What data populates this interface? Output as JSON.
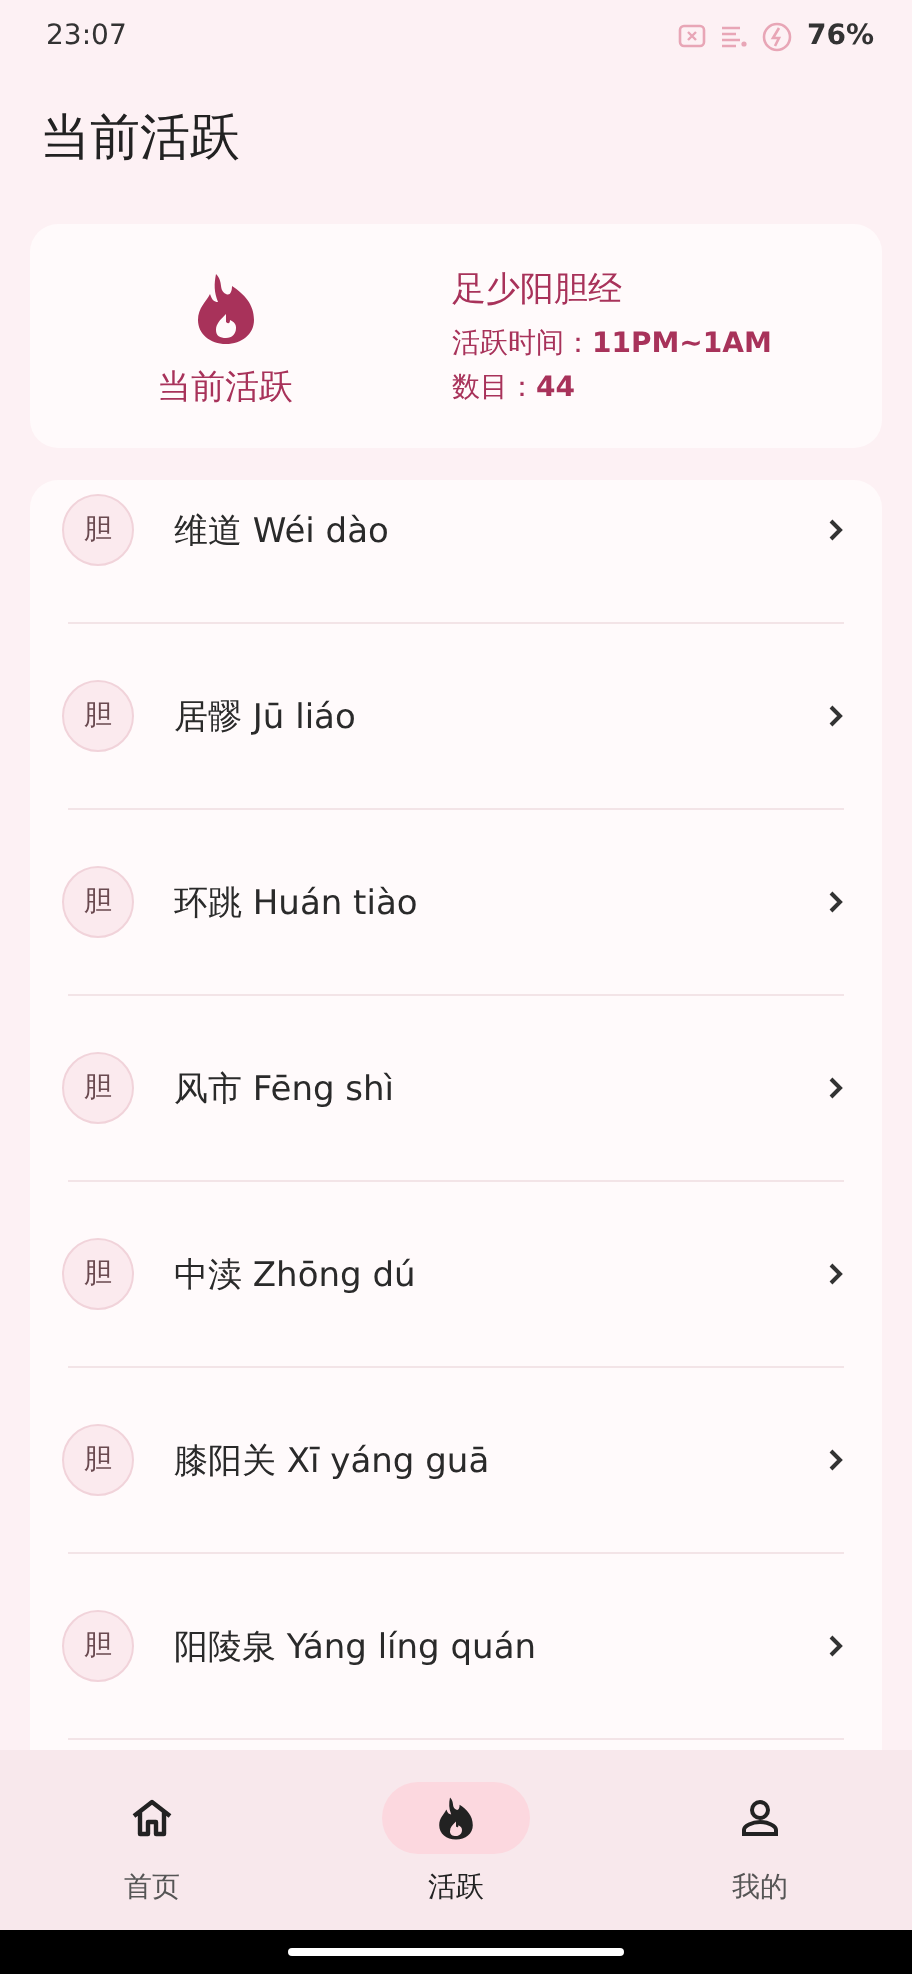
{
  "status_bar": {
    "time": "23:07",
    "battery": "76%"
  },
  "page_title": "当前活跃",
  "active_card": {
    "label": "当前活跃",
    "meridian": "足少阳胆经",
    "time": "活跃时间：**11PM~1AM**",
    "count": "数目：**44**"
  },
  "points": [
    {
      "badge": "胆",
      "name": "维道 Wéi dào"
    },
    {
      "badge": "胆",
      "name": "居髎 Jū liáo"
    },
    {
      "badge": "胆",
      "name": "环跳 Huán tiào"
    },
    {
      "badge": "胆",
      "name": "风市 Fēng shì"
    },
    {
      "badge": "胆",
      "name": "中渎 Zhōng dú"
    },
    {
      "badge": "胆",
      "name": "膝阳关 Xī yáng guā"
    },
    {
      "badge": "胆",
      "name": "阳陵泉 Yáng líng quán"
    }
  ],
  "nav": [
    {
      "kind": "home",
      "label": "首页",
      "selected": false
    },
    {
      "kind": "flame",
      "label": "活跃",
      "selected": true
    },
    {
      "kind": "person",
      "label": "我的",
      "selected": false
    }
  ]
}
